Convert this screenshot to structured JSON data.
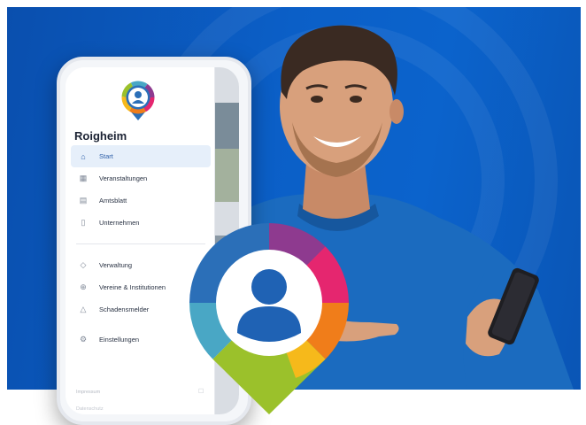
{
  "app": {
    "town": "Roigheim",
    "menu_primary": [
      {
        "label": "Start",
        "icon": "home-icon",
        "active": true
      },
      {
        "label": "Veranstaltungen",
        "icon": "calendar-icon",
        "active": false
      },
      {
        "label": "Amtsblatt",
        "icon": "newspaper-icon",
        "active": false
      },
      {
        "label": "Unternehmen",
        "icon": "building-icon",
        "active": false
      }
    ],
    "menu_secondary": [
      {
        "label": "Verwaltung",
        "icon": "shield-icon"
      },
      {
        "label": "Vereine & Institutionen",
        "icon": "globe-icon"
      },
      {
        "label": "Schadensmelder",
        "icon": "warning-icon"
      }
    ],
    "menu_settings": {
      "label": "Einstellungen",
      "icon": "gear-icon"
    },
    "footer": {
      "line1": "Impressum",
      "line2": "Datenschutz"
    }
  },
  "colors": {
    "background_blue": "#0b5fc7",
    "accent_blue": "#1f62b4",
    "ring_segments": [
      "#8e3a8f",
      "#e5266f",
      "#f07d1a",
      "#f6b91b",
      "#9bc12b",
      "#49a7c5",
      "#2b6fb8"
    ]
  }
}
